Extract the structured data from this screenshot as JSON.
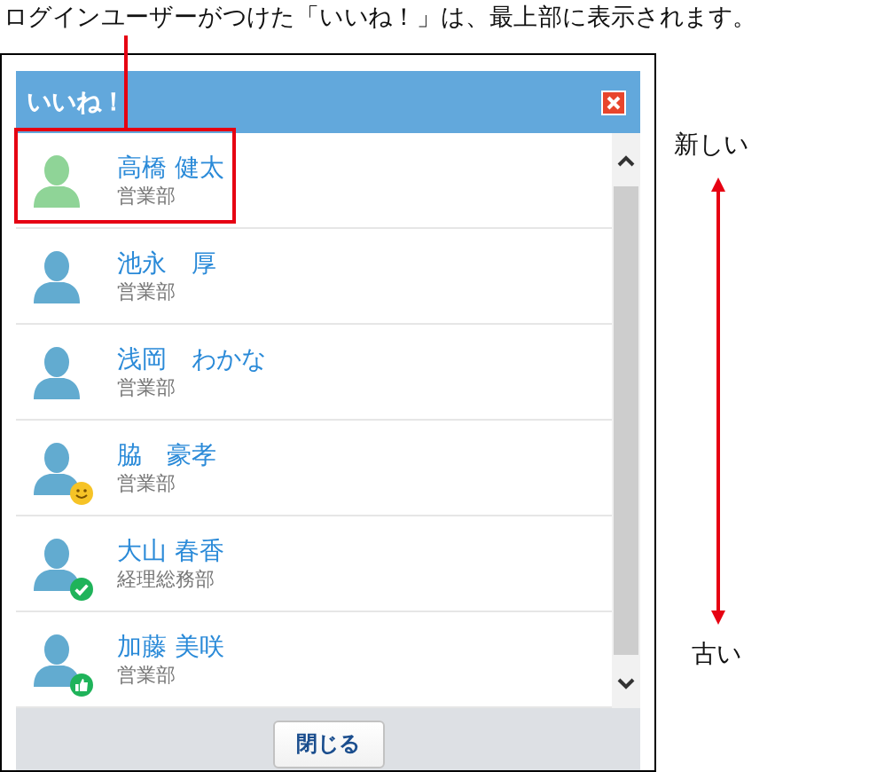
{
  "caption": "ログインユーザーがつけた「いいね！」は、最上部に表示されます。",
  "dialog": {
    "title": "いいね！",
    "close_button": "閉じる"
  },
  "users": [
    {
      "name": "高橋 健太",
      "department": "営業部",
      "login_user": true,
      "kind": "plain"
    },
    {
      "name": "池永　厚",
      "department": "営業部",
      "login_user": false,
      "kind": "plain"
    },
    {
      "name": "浅岡　わかな",
      "department": "営業部",
      "login_user": false,
      "kind": "plain"
    },
    {
      "name": "脇　豪孝",
      "department": "営業部",
      "login_user": false,
      "kind": "smile"
    },
    {
      "name": "大山 春香",
      "department": "経理総務部",
      "login_user": false,
      "kind": "check"
    },
    {
      "name": "加藤 美咲",
      "department": "営業部",
      "login_user": false,
      "kind": "thumb"
    }
  ],
  "order_legend": {
    "top": "新しい",
    "bottom": "古い"
  }
}
